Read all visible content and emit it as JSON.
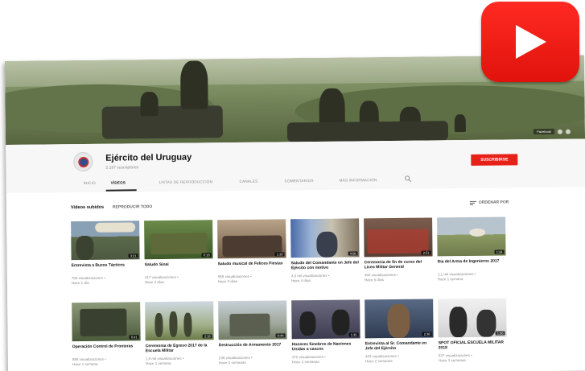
{
  "channel": {
    "name": "Ejército del Uruguay",
    "subscribers": "2.197 suscriptores",
    "subscribe_label": "SUSCRIBIRSE",
    "banner_link": "Facebook"
  },
  "tabs": [
    {
      "label": "INICIO"
    },
    {
      "label": "VÍDEOS"
    },
    {
      "label": "LISTAS DE REPRODUCCIÓN"
    },
    {
      "label": "CANALES"
    },
    {
      "label": "COMENTARIOS"
    },
    {
      "label": "MÁS INFORMACIÓN"
    }
  ],
  "section": {
    "title": "Videos subidos",
    "play_all": "REPRODUCIR TODO",
    "sort_label": "ORDENAR POR"
  },
  "videos": [
    {
      "title": "Entrevista a Buzos Tácticos",
      "duration": "3:21",
      "views": "793 visualizaciones •",
      "age": "Hace 1 día"
    },
    {
      "title": "Saludo Sinai",
      "duration": "0:18",
      "views": "417 visualizaciones •",
      "age": "Hace 2 días"
    },
    {
      "title": "Saludo musical de Felices Fiestas",
      "duration": "1:33",
      "views": "955 visualizaciones •",
      "age": "Hace 3 días"
    },
    {
      "title": "Saludo del Comandante en Jefe del Ejército con motivo",
      "duration": "4:58",
      "views": "3,4 mil visualizaciones •",
      "age": "Hace 4 días"
    },
    {
      "title": "Ceremonia de fin de curso del Liceo Militar General",
      "duration": "2:51",
      "views": "460 visualizaciones •",
      "age": "Hace 6 días"
    },
    {
      "title": "Día del Arma de Ingenieros 2017",
      "duration": "1:24",
      "views": "1,1 mil visualizaciones •",
      "age": "Hace 1 semana"
    },
    {
      "title": "Operación Control de Fronteras",
      "duration": "0:41",
      "views": "888 visualizaciones •",
      "age": "Hace 1 semana"
    },
    {
      "title": "Ceremonia de Egreso 2017 de la Escuela Militar",
      "duration": "2:18",
      "views": "1,5 mil visualizaciones •",
      "age": "Hace 1 semana"
    },
    {
      "title": "Destrucción de Armamento 2017",
      "duration": "0:44",
      "views": "235 visualizaciones •",
      "age": "Hace 2 semanas"
    },
    {
      "title": "Honores fúnebres de Naciones Unidas a cascos",
      "duration": "1:35",
      "views": "370 visualizaciones •",
      "age": "Hace 2 semanas"
    },
    {
      "title": "Entrevista al Sr. Comandante en Jefe del Ejército",
      "duration": "2:38",
      "views": "343 visualizaciones •",
      "age": "Hace 2 semanas"
    },
    {
      "title": "SPOT OFICIAL ESCUELA MILITAR 2018",
      "duration": "1:36",
      "views": "937 visualizaciones •",
      "age": "Hace 3 semanas"
    }
  ],
  "colors": {
    "subscribe": "#e62117",
    "youtube_red": "#ff2a22",
    "active_tab": "#222222"
  },
  "icons": {
    "search": "search-icon",
    "sort": "sort-icon",
    "play": "play-icon"
  }
}
